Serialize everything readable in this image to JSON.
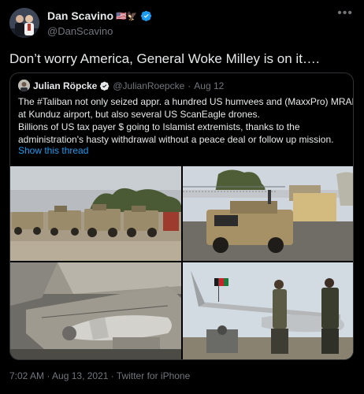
{
  "tweet": {
    "author_name": "Dan Scavino",
    "author_emoji": "🇺🇸🦅",
    "handle": "@DanScavino",
    "text": "Don’t worry America, General Woke Milley is on it….",
    "timestamp": "7:02 AM · Aug 13, 2021",
    "separator": " · ",
    "source": "Twitter for iPhone"
  },
  "quote": {
    "author_name": "Julian Röpcke",
    "handle": "@JulianRoepcke",
    "dot": "·",
    "date": "Aug 12",
    "lines": [
      "The #Taliban not only seized appr. a hundred US humvees and (MaxxPro) MRAPs",
      "at Kunduz airport, but also several US ScanEagle drones.",
      "Billions of US tax payer $ going to Islamist extremists, thanks to the",
      "administration's hasty withdrawal without a peace deal or follow up mission."
    ],
    "show_thread": "Show this thread"
  },
  "colors": {
    "background": "#000000",
    "text": "#e7e9ea",
    "muted": "#71767b",
    "link": "#1d9bf0",
    "verified": "#1d9bf0",
    "border": "#2f3336"
  },
  "icons": {
    "verified": "verified-badge-icon",
    "more": "more-horizontal-icon"
  }
}
